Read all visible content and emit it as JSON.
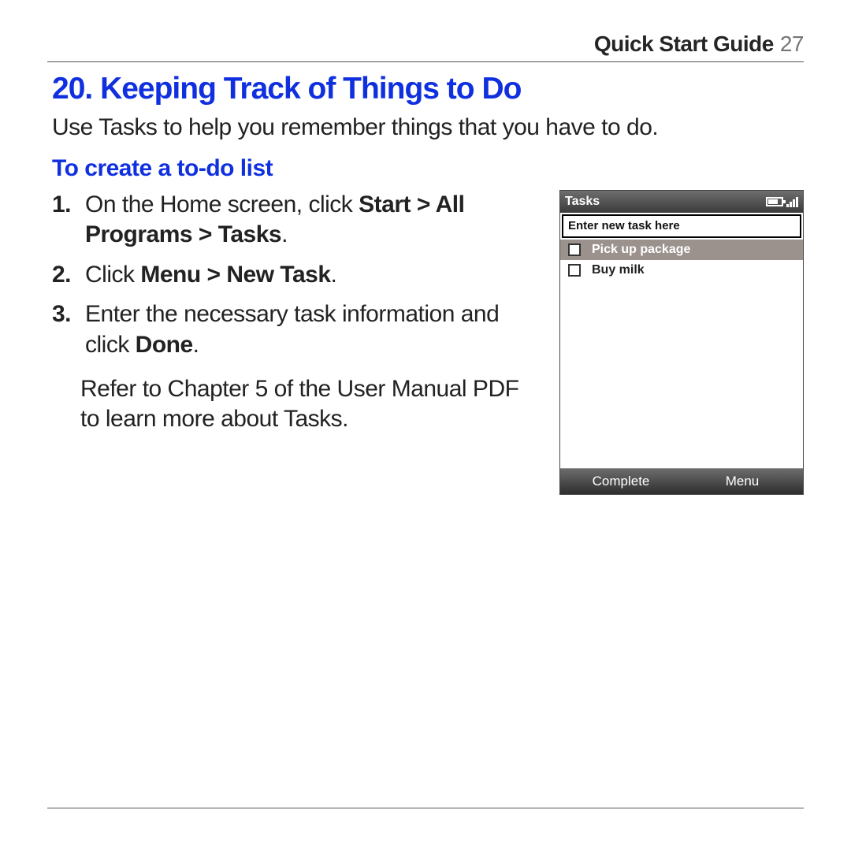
{
  "header": {
    "title": "Quick Start Guide",
    "page_number": "27"
  },
  "section": {
    "number": "20.",
    "title": "Keeping Track of Things to Do"
  },
  "intro": "Use Tasks to help you remember things that you have to do.",
  "subsection": "To create a to-do list",
  "steps": [
    {
      "marker": "1.",
      "pre": "On the Home screen, click ",
      "bold": "Start > All Programs > Tasks",
      "post": "."
    },
    {
      "marker": "2.",
      "pre": "Click ",
      "bold": "Menu > New Task",
      "post": "."
    },
    {
      "marker": "3.",
      "pre": "Enter the necessary task information and click ",
      "bold": "Done",
      "post": "."
    }
  ],
  "after_steps": "Refer to Chapter 5 of the User Manual PDF to learn more about Tasks.",
  "phone": {
    "title": "Tasks",
    "input_placeholder": "Enter new task here",
    "tasks": [
      {
        "label": "Pick up package",
        "selected": true
      },
      {
        "label": "Buy milk",
        "selected": false
      }
    ],
    "softkey_left": "Complete",
    "softkey_right": "Menu"
  }
}
